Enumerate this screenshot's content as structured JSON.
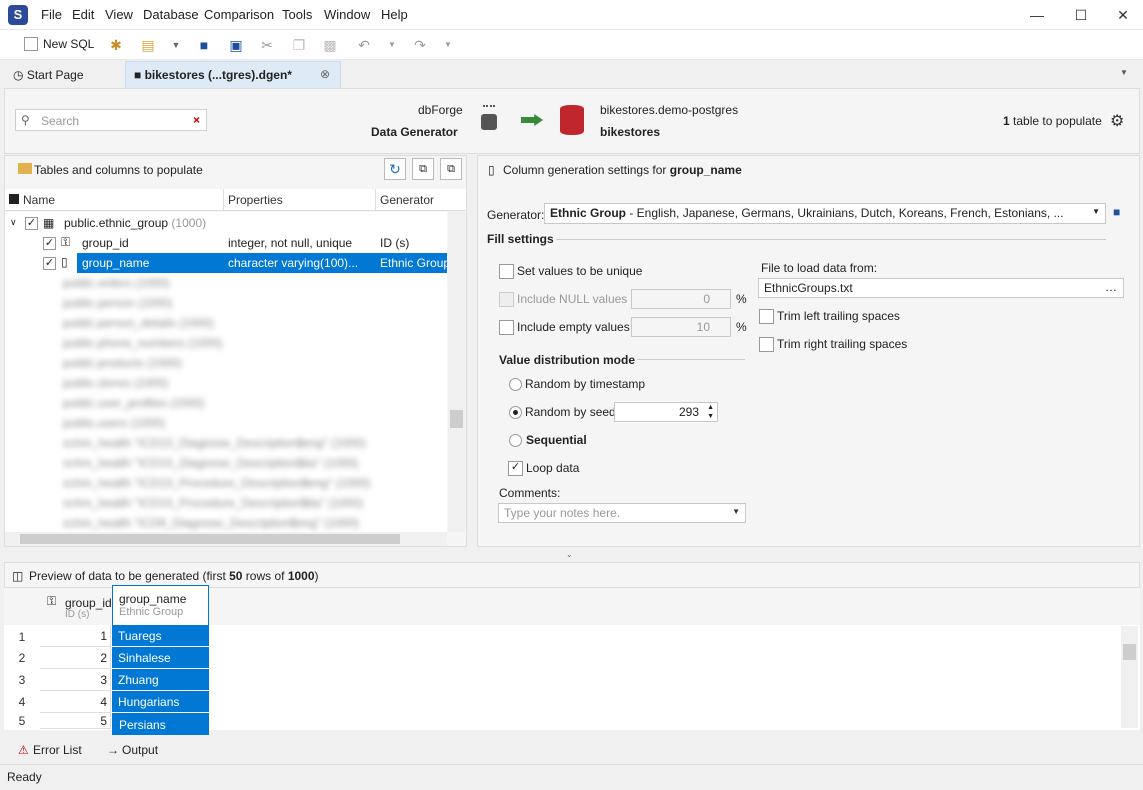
{
  "menu": [
    "File",
    "Edit",
    "View",
    "Database",
    "Comparison",
    "Tools",
    "Window",
    "Help"
  ],
  "toolbar": {
    "new_sql": "New SQL"
  },
  "tabs": {
    "start": "Start Page",
    "doc": "bikestores (...tgres).dgen*"
  },
  "header": {
    "search_placeholder": "Search",
    "product1": "dbForge",
    "product2": "Data Generator",
    "conn_server": "bikestores.demo-postgres",
    "conn_db": "bikestores",
    "table_count": "1",
    "table_count_label": " table to populate"
  },
  "left": {
    "title": "Tables and columns to populate",
    "cols": [
      "Name",
      "Properties",
      "Generator"
    ],
    "table": {
      "name": "public.ethnic_group",
      "count": "(1000)"
    },
    "rows": [
      {
        "name": "group_id",
        "props": "integer, not null, unique",
        "gen": "ID (s)"
      },
      {
        "name": "group_name",
        "props": "character varying(100)...",
        "gen": "Ethnic Group"
      }
    ],
    "blurred": [
      "public.orders (1000)",
      "public.person (1000)",
      "public.person_details (1000)",
      "public.phone_numbers (1000)",
      "public.products (1000)",
      "public.stores (1000)",
      "public.user_profiles (1000)",
      "public.users (1000)",
      "schm_health \"ICD10_Diagnose_Description$eng\" (1000)",
      "schm_health \"ICD10_Diagnose_Description$ita\" (1000)",
      "schm_health \"ICD10_Procedure_Description$eng\" (1000)",
      "schm_health \"ICD10_Procedure_Description$ita\" (1000)",
      "schm_health \"ICD9_Diagnose_Description$eng\" (1000)"
    ]
  },
  "right": {
    "title_prefix": "Column generation settings for ",
    "title_col": "group_name",
    "gen_label": "Generator:",
    "gen_value_bold": "Ethnic Group",
    "gen_value_rest": " - English, Japanese, Germans, Ukrainians, Dutch, Koreans, French, Estonians, ...",
    "fill": "Fill settings",
    "unique": "Set values to be unique",
    "null": "Include NULL values",
    "null_val": "0",
    "empty": "Include empty values",
    "empty_val": "10",
    "pct": "%",
    "file_label": "File to load data from:",
    "file_val": "EthnicGroups.txt",
    "trim_left": "Trim left trailing spaces",
    "trim_right": "Trim right trailing spaces",
    "dist": "Value distribution mode",
    "r1": "Random by timestamp",
    "r2": "Random by seed",
    "seed": "293",
    "r3": "Sequential",
    "loop": "Loop data",
    "comments": "Comments:",
    "comments_ph": "Type your notes here."
  },
  "preview": {
    "prefix": "Preview of data to be generated (first ",
    "n1": "50",
    "mid": " rows of ",
    "n2": "1000",
    "suffix": ")",
    "col1": "group_id",
    "col1sub": "ID (s)",
    "col2": "group_name",
    "col2sub": "Ethnic Group",
    "rows": [
      {
        "n": "1",
        "id": "1",
        "name": "Tuaregs"
      },
      {
        "n": "2",
        "id": "2",
        "name": "Sinhalese"
      },
      {
        "n": "3",
        "id": "3",
        "name": "Zhuang"
      },
      {
        "n": "4",
        "id": "4",
        "name": "Hungarians"
      },
      {
        "n": "5",
        "id": "5",
        "name": "Persians"
      }
    ]
  },
  "bottom": {
    "errors": "Error List",
    "output": "Output",
    "status": "Ready"
  }
}
